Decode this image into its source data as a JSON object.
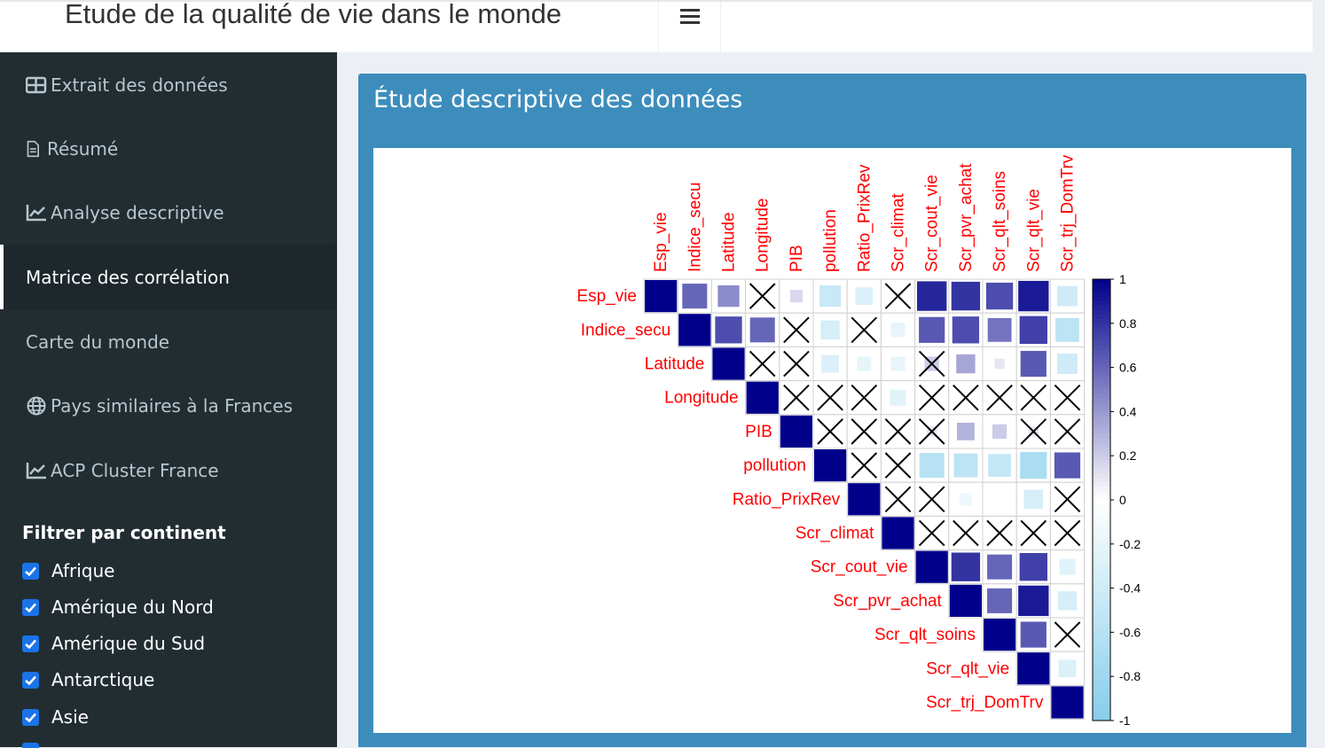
{
  "header": {
    "title": "Etude de la qualité de vie dans le monde"
  },
  "sidebar": {
    "items": [
      {
        "label": "Extrait des données",
        "icon": "table-icon"
      },
      {
        "label": "Résumé",
        "icon": "file-icon"
      },
      {
        "label": "Analyse descriptive",
        "icon": "line-chart-icon"
      },
      {
        "label": "Matrice des corrélation",
        "icon": ""
      },
      {
        "label": "Carte du monde",
        "icon": ""
      },
      {
        "label": "Pays similaires à la Frances",
        "icon": "globe-icon"
      },
      {
        "label": "ACP Cluster France",
        "icon": "line-chart-icon"
      }
    ],
    "filter_title": "Filtrer par continent",
    "continents": [
      {
        "label": "Afrique",
        "checked": true
      },
      {
        "label": "Amérique du Nord",
        "checked": true
      },
      {
        "label": "Amérique du Sud",
        "checked": true
      },
      {
        "label": "Antarctique",
        "checked": true
      },
      {
        "label": "Asie",
        "checked": true
      }
    ]
  },
  "box": {
    "title": "Étude descriptive des données"
  },
  "chart_data": {
    "type": "heatmap",
    "variables": [
      "Esp_vie",
      "Indice_secu",
      "Latitude",
      "Longitude",
      "PIB",
      "pollution",
      "Ratio_PrixRev",
      "Scr_climat",
      "Scr_cout_vie",
      "Scr_pvr_achat",
      "Scr_qlt_soins",
      "Scr_qlt_vie",
      "Scr_trj_DomTrv"
    ],
    "matrix_upper": [
      [
        1,
        0.6,
        0.45,
        0.0,
        0.15,
        -0.45,
        -0.3,
        0.05,
        0.85,
        0.8,
        0.7,
        0.9,
        -0.4
      ],
      [
        null,
        1,
        0.7,
        0.6,
        0.0,
        -0.35,
        0.0,
        -0.2,
        0.65,
        0.7,
        0.55,
        0.75,
        -0.55
      ],
      [
        null,
        null,
        1,
        0.0,
        0.0,
        -0.3,
        -0.2,
        -0.2,
        0.2,
        0.35,
        0.1,
        0.65,
        -0.4
      ],
      [
        null,
        null,
        null,
        1,
        0.0,
        0.0,
        0.0,
        -0.25,
        0.0,
        0.0,
        0.0,
        0.0,
        0.0
      ],
      [
        null,
        null,
        null,
        null,
        1,
        0.0,
        0.0,
        0.0,
        0.1,
        0.3,
        0.2,
        0.1,
        0.0
      ],
      [
        null,
        null,
        null,
        null,
        null,
        1,
        0.0,
        0.0,
        -0.6,
        -0.55,
        -0.5,
        -0.7,
        0.65
      ],
      [
        null,
        null,
        null,
        null,
        null,
        null,
        1,
        0.0,
        0.0,
        -0.15,
        0.0,
        -0.35,
        0.0
      ],
      [
        null,
        null,
        null,
        null,
        null,
        null,
        null,
        1,
        0.0,
        0.0,
        0.0,
        0.0,
        0.0
      ],
      [
        null,
        null,
        null,
        null,
        null,
        null,
        null,
        null,
        1,
        0.8,
        0.6,
        0.75,
        -0.25
      ],
      [
        null,
        null,
        null,
        null,
        null,
        null,
        null,
        null,
        null,
        1,
        0.6,
        0.9,
        -0.35
      ],
      [
        null,
        null,
        null,
        null,
        null,
        null,
        null,
        null,
        null,
        null,
        1,
        0.65,
        0.0
      ],
      [
        null,
        null,
        null,
        null,
        null,
        null,
        null,
        null,
        null,
        null,
        null,
        1,
        -0.3
      ],
      [
        null,
        null,
        null,
        null,
        null,
        null,
        null,
        null,
        null,
        null,
        null,
        null,
        1
      ]
    ],
    "insignificant_cells": [
      [
        0,
        3
      ],
      [
        0,
        7
      ],
      [
        1,
        4
      ],
      [
        1,
        6
      ],
      [
        2,
        3
      ],
      [
        2,
        4
      ],
      [
        2,
        8
      ],
      [
        3,
        4
      ],
      [
        3,
        5
      ],
      [
        3,
        6
      ],
      [
        3,
        8
      ],
      [
        3,
        9
      ],
      [
        3,
        10
      ],
      [
        3,
        11
      ],
      [
        3,
        12
      ],
      [
        4,
        5
      ],
      [
        4,
        6
      ],
      [
        4,
        7
      ],
      [
        4,
        8
      ],
      [
        4,
        11
      ],
      [
        4,
        12
      ],
      [
        5,
        6
      ],
      [
        5,
        7
      ],
      [
        6,
        7
      ],
      [
        6,
        8
      ],
      [
        6,
        12
      ],
      [
        7,
        8
      ],
      [
        7,
        9
      ],
      [
        7,
        10
      ],
      [
        7,
        11
      ],
      [
        7,
        12
      ],
      [
        10,
        12
      ]
    ],
    "colorbar": {
      "ticks": [
        "1",
        "0.8",
        "0.6",
        "0.4",
        "0.2",
        "0",
        "-0.2",
        "-0.4",
        "-0.6",
        "-0.8",
        "-1"
      ],
      "min": -1,
      "max": 1
    },
    "colors": {
      "positive": "#00008B",
      "negative": "#87CEEB",
      "label": "#FF0000"
    }
  }
}
